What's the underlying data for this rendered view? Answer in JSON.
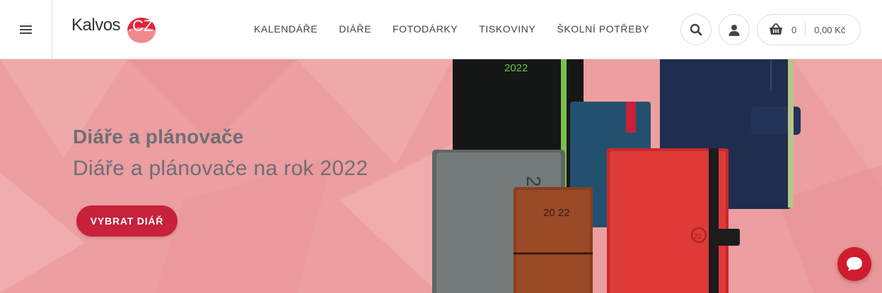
{
  "header": {
    "logo": {
      "text": "Kalvos",
      "suffix": ".CZ",
      "accent": "#e0233f"
    },
    "nav": [
      {
        "label": "KALENDÁŘE"
      },
      {
        "label": "DIÁŘE"
      },
      {
        "label": "FOTODÁRKY"
      },
      {
        "label": "TISKOVINY"
      },
      {
        "label": "ŠKOLNÍ POTŘEBY"
      }
    ],
    "icons": {
      "menu": "hamburger-icon",
      "search": "search-icon",
      "user": "user-icon",
      "cart": "basket-icon"
    },
    "cart": {
      "count": "0",
      "price": "0,00 Kč"
    }
  },
  "hero": {
    "title": "Diáře a plánovače",
    "subtitle": "Diáře a plánovače na rok 2022",
    "button_label": "VYBRAT DIÁŘ",
    "button_color": "#c8213a",
    "background_color": "#ec9ea0",
    "products": {
      "black_diary_year": "2022",
      "grey_diary_year": "2022",
      "brown_diary_year": "20 22",
      "red_diary_year": "22"
    }
  },
  "chat": {
    "icon": "chat-bubble-icon",
    "color": "#d01c2e"
  }
}
